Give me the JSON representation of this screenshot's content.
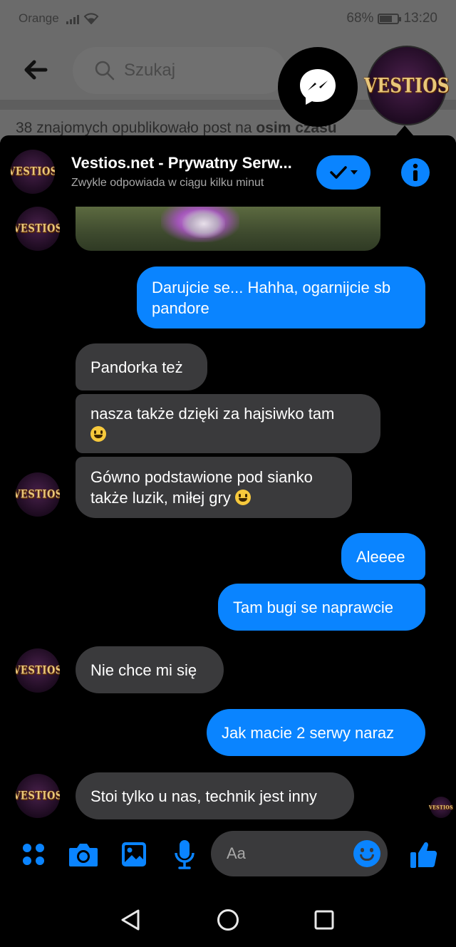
{
  "status_bar": {
    "carrier": "Orange",
    "battery": "68%",
    "time": "13:20"
  },
  "background_page": {
    "search_placeholder": "Szukaj",
    "post_line_prefix": "38 znajomych opublikowało post na",
    "post_line_bold": "osim czasu"
  },
  "chat_heads": [
    {
      "name": "messenger-chathead",
      "icon": "messenger-icon"
    },
    {
      "name": "vestios-chathead",
      "logo_text": "VESTIOS"
    }
  ],
  "chat_header": {
    "title": "Vestios.net - Prywatny Serw...",
    "subtitle": "Zwykle odpowiada w ciągu kilku minut",
    "avatar_logo": "VESTIOS"
  },
  "messages": [
    {
      "side": "out",
      "text": "Darujcie se... Hahha, ogarnijcie sb pandore"
    },
    {
      "side": "in",
      "text": "Pandorka też"
    },
    {
      "side": "in",
      "text": "nasza także dzięki za hajsiwko tam",
      "emoji": "grinning-face"
    },
    {
      "side": "in",
      "text": "Gówno podstawione pod sianko także luzik, miłej gry",
      "emoji": "grinning-face"
    },
    {
      "side": "out",
      "text": "Aleeee"
    },
    {
      "side": "out",
      "text": "Tam bugi se naprawcie"
    },
    {
      "side": "in",
      "text": "Nie chce mi się"
    },
    {
      "side": "out",
      "text": "Jak macie 2 serwy naraz"
    },
    {
      "side": "in",
      "text": "Stoi tylko u nas, technik jest inny"
    }
  ],
  "composer": {
    "placeholder": "Aa",
    "icons": [
      "menu-dots-icon",
      "camera-icon",
      "gallery-icon",
      "microphone-icon",
      "emoji-icon",
      "thumbs-up-icon"
    ]
  },
  "colors": {
    "accent": "#0a84ff",
    "incoming_bubble": "#3a3a3c",
    "background": "#000000"
  }
}
